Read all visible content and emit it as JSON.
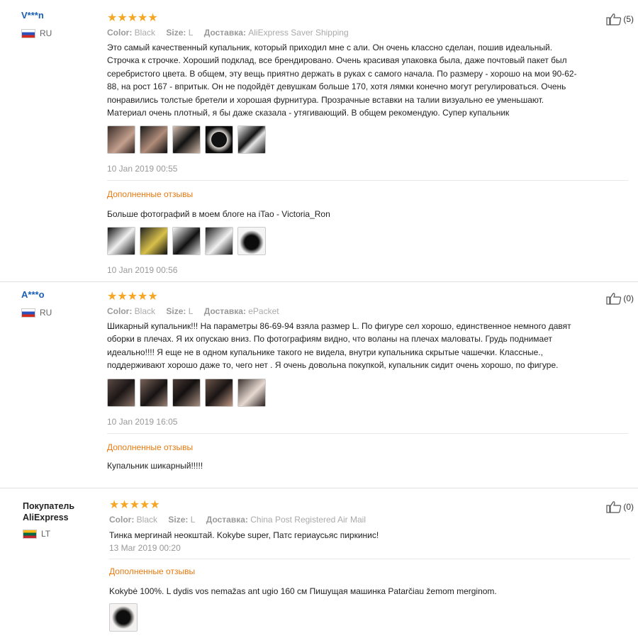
{
  "reviews": [
    {
      "user": "V***n",
      "country": "RU",
      "stars": "★★★★★",
      "color_label": "Color:",
      "color": "Black",
      "size_label": "Size:",
      "size": "L",
      "delivery_label": "Доставка:",
      "delivery": "AliExpress Saver Shipping",
      "likes": "(5)",
      "text_lines": [
        "Это самый качественный купальник, который приходил мне с али. Он очень классно сделан, пошив идеальный.",
        "Строчка к строчке. Хороший подклад, все брендировано. Очень красивая упаковка была, даже почтовый пакет был",
        "серебристого цвета. В общем, эту вещь приятно держать в руках с самого начала. По размеру - хорошо на мои 90-62-",
        "88, на рост 167 - впритык. Он не подойдёт девушкам больше 170, хотя лямки конечно могут регулироваться. Очень",
        "понравились толстые бретели и хорошая фурнитура. Прозрачные вставки на талии визуально ее уменьшают.",
        "Материал очень плотный, я бы даже сказала - утягивающий. В общем рекомендую. Супер купальник"
      ],
      "date": "10 Jan 2019 00:55",
      "extra_title": "Дополненные отзывы",
      "extra_text": "Больше фотографий в моем блоге на iTao - Victoria_Ron",
      "extra_date": "10 Jan 2019 00:56"
    },
    {
      "user": "A***o",
      "country": "RU",
      "stars": "★★★★★",
      "color_label": "Color:",
      "color": "Black",
      "size_label": "Size:",
      "size": "L",
      "delivery_label": "Доставка:",
      "delivery": "ePacket",
      "likes": "(0)",
      "text_lines": [
        "Шикарный купальник!!! На параметры 86-69-94 взяла размер L. По фигуре сел хорошо, единственное немного давят",
        "оборки в плечах. Я их опускаю вниз. По фотографиям видно, что воланы на плечах маловаты. Грудь поднимает",
        "идеально!!!! Я еще не в одном купальнике такого не видела, внутри купальника скрытые чашечки. Классные.,",
        "поддерживают хорошо даже то, чего нет . Я очень довольна покупкой, купальник сидит очень хорошо, по фигуре."
      ],
      "date": "10 Jan 2019 16:05",
      "extra_title": "Дополненные отзывы",
      "extra_text": "Купальник шикарный!!!!!"
    },
    {
      "user_line1": "Покупатель",
      "user_line2": "AliExpress",
      "country": "LT",
      "stars": "★★★★★",
      "color_label": "Color:",
      "color": "Black",
      "size_label": "Size:",
      "size": "L",
      "delivery_label": "Доставка:",
      "delivery": "China Post Registered Air Mail",
      "likes": "(0)",
      "text": "Тинка мергинай неокштай. Kokybe super, Патс гериаусьяс пиркинис!",
      "date": "13 Mar 2019 00:20",
      "extra_title": "Дополненные отзывы",
      "extra_text": "Kokybė 100%. L dydis vos nemažas ant ugio 160 см Пишущая машинка Patarčiau žemom merginom."
    }
  ]
}
